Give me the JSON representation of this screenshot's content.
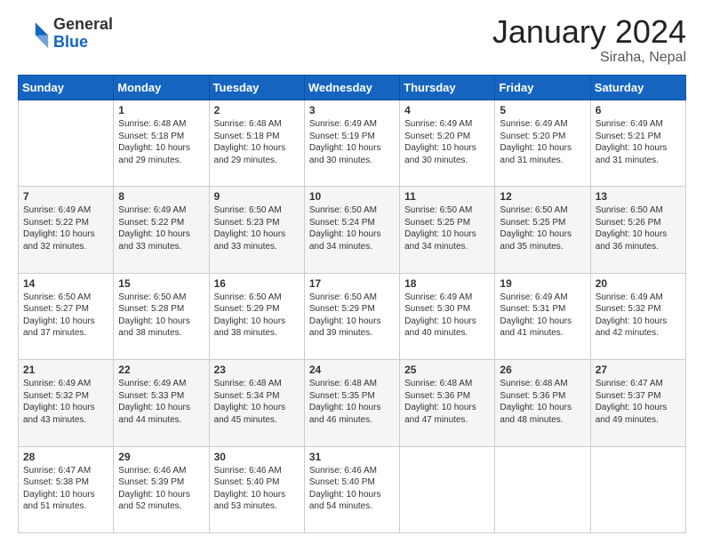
{
  "header": {
    "logo": {
      "general": "General",
      "blue": "Blue"
    },
    "title": "January 2024",
    "location": "Siraha, Nepal"
  },
  "days_of_week": [
    "Sunday",
    "Monday",
    "Tuesday",
    "Wednesday",
    "Thursday",
    "Friday",
    "Saturday"
  ],
  "weeks": [
    [
      {
        "day": null,
        "info": null
      },
      {
        "day": "1",
        "sunrise": "6:48 AM",
        "sunset": "5:18 PM",
        "daylight": "10 hours and 29 minutes."
      },
      {
        "day": "2",
        "sunrise": "6:48 AM",
        "sunset": "5:18 PM",
        "daylight": "10 hours and 29 minutes."
      },
      {
        "day": "3",
        "sunrise": "6:49 AM",
        "sunset": "5:19 PM",
        "daylight": "10 hours and 30 minutes."
      },
      {
        "day": "4",
        "sunrise": "6:49 AM",
        "sunset": "5:20 PM",
        "daylight": "10 hours and 30 minutes."
      },
      {
        "day": "5",
        "sunrise": "6:49 AM",
        "sunset": "5:20 PM",
        "daylight": "10 hours and 31 minutes."
      },
      {
        "day": "6",
        "sunrise": "6:49 AM",
        "sunset": "5:21 PM",
        "daylight": "10 hours and 31 minutes."
      }
    ],
    [
      {
        "day": "7",
        "sunrise": "6:49 AM",
        "sunset": "5:22 PM",
        "daylight": "10 hours and 32 minutes."
      },
      {
        "day": "8",
        "sunrise": "6:49 AM",
        "sunset": "5:22 PM",
        "daylight": "10 hours and 33 minutes."
      },
      {
        "day": "9",
        "sunrise": "6:50 AM",
        "sunset": "5:23 PM",
        "daylight": "10 hours and 33 minutes."
      },
      {
        "day": "10",
        "sunrise": "6:50 AM",
        "sunset": "5:24 PM",
        "daylight": "10 hours and 34 minutes."
      },
      {
        "day": "11",
        "sunrise": "6:50 AM",
        "sunset": "5:25 PM",
        "daylight": "10 hours and 34 minutes."
      },
      {
        "day": "12",
        "sunrise": "6:50 AM",
        "sunset": "5:25 PM",
        "daylight": "10 hours and 35 minutes."
      },
      {
        "day": "13",
        "sunrise": "6:50 AM",
        "sunset": "5:26 PM",
        "daylight": "10 hours and 36 minutes."
      }
    ],
    [
      {
        "day": "14",
        "sunrise": "6:50 AM",
        "sunset": "5:27 PM",
        "daylight": "10 hours and 37 minutes."
      },
      {
        "day": "15",
        "sunrise": "6:50 AM",
        "sunset": "5:28 PM",
        "daylight": "10 hours and 38 minutes."
      },
      {
        "day": "16",
        "sunrise": "6:50 AM",
        "sunset": "5:29 PM",
        "daylight": "10 hours and 38 minutes."
      },
      {
        "day": "17",
        "sunrise": "6:50 AM",
        "sunset": "5:29 PM",
        "daylight": "10 hours and 39 minutes."
      },
      {
        "day": "18",
        "sunrise": "6:49 AM",
        "sunset": "5:30 PM",
        "daylight": "10 hours and 40 minutes."
      },
      {
        "day": "19",
        "sunrise": "6:49 AM",
        "sunset": "5:31 PM",
        "daylight": "10 hours and 41 minutes."
      },
      {
        "day": "20",
        "sunrise": "6:49 AM",
        "sunset": "5:32 PM",
        "daylight": "10 hours and 42 minutes."
      }
    ],
    [
      {
        "day": "21",
        "sunrise": "6:49 AM",
        "sunset": "5:32 PM",
        "daylight": "10 hours and 43 minutes."
      },
      {
        "day": "22",
        "sunrise": "6:49 AM",
        "sunset": "5:33 PM",
        "daylight": "10 hours and 44 minutes."
      },
      {
        "day": "23",
        "sunrise": "6:48 AM",
        "sunset": "5:34 PM",
        "daylight": "10 hours and 45 minutes."
      },
      {
        "day": "24",
        "sunrise": "6:48 AM",
        "sunset": "5:35 PM",
        "daylight": "10 hours and 46 minutes."
      },
      {
        "day": "25",
        "sunrise": "6:48 AM",
        "sunset": "5:36 PM",
        "daylight": "10 hours and 47 minutes."
      },
      {
        "day": "26",
        "sunrise": "6:48 AM",
        "sunset": "5:36 PM",
        "daylight": "10 hours and 48 minutes."
      },
      {
        "day": "27",
        "sunrise": "6:47 AM",
        "sunset": "5:37 PM",
        "daylight": "10 hours and 49 minutes."
      }
    ],
    [
      {
        "day": "28",
        "sunrise": "6:47 AM",
        "sunset": "5:38 PM",
        "daylight": "10 hours and 51 minutes."
      },
      {
        "day": "29",
        "sunrise": "6:46 AM",
        "sunset": "5:39 PM",
        "daylight": "10 hours and 52 minutes."
      },
      {
        "day": "30",
        "sunrise": "6:46 AM",
        "sunset": "5:40 PM",
        "daylight": "10 hours and 53 minutes."
      },
      {
        "day": "31",
        "sunrise": "6:46 AM",
        "sunset": "5:40 PM",
        "daylight": "10 hours and 54 minutes."
      },
      {
        "day": null,
        "info": null
      },
      {
        "day": null,
        "info": null
      },
      {
        "day": null,
        "info": null
      }
    ]
  ],
  "labels": {
    "sunrise": "Sunrise:",
    "sunset": "Sunset:",
    "daylight": "Daylight:"
  }
}
